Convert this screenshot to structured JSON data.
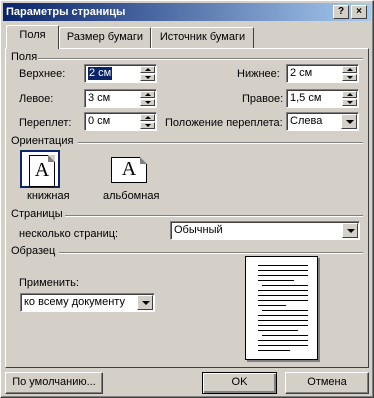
{
  "window": {
    "title": "Параметры страницы"
  },
  "titlebar_buttons": {
    "help": "?",
    "close": "×"
  },
  "tabs": [
    {
      "label": "Поля",
      "active": true
    },
    {
      "label": "Размер бумаги",
      "active": false
    },
    {
      "label": "Источник бумаги",
      "active": false
    }
  ],
  "margins": {
    "section_title": "Поля",
    "top": {
      "label": "Верхнее:",
      "value": "2 см"
    },
    "bottom": {
      "label": "Нижнее:",
      "value": "2 см"
    },
    "left": {
      "label": "Левое:",
      "value": "3 см"
    },
    "right": {
      "label": "Правое:",
      "value": "1,5 см"
    },
    "gutter": {
      "label": "Переплет:",
      "value": "0 см"
    },
    "gutter_pos": {
      "label": "Положение переплета:",
      "value": "Слева"
    }
  },
  "orientation": {
    "section_title": "Ориентация",
    "portrait": {
      "label": "книжная",
      "glyph": "A",
      "selected": true
    },
    "landscape": {
      "label": "альбомная",
      "glyph": "A",
      "selected": false
    }
  },
  "pages": {
    "section_title": "Страницы",
    "multiple_label": "несколько страниц:",
    "multiple_value": "Обычный"
  },
  "sample": {
    "section_title": "Образец",
    "apply_label": "Применить:",
    "apply_value": "ко всему документу"
  },
  "buttons": {
    "default": "По умолчанию...",
    "ok": "OK",
    "cancel": "Отмена"
  },
  "colors": {
    "title_start": "#0a246a",
    "title_end": "#a6caf0",
    "face": "#d4d0c8"
  }
}
